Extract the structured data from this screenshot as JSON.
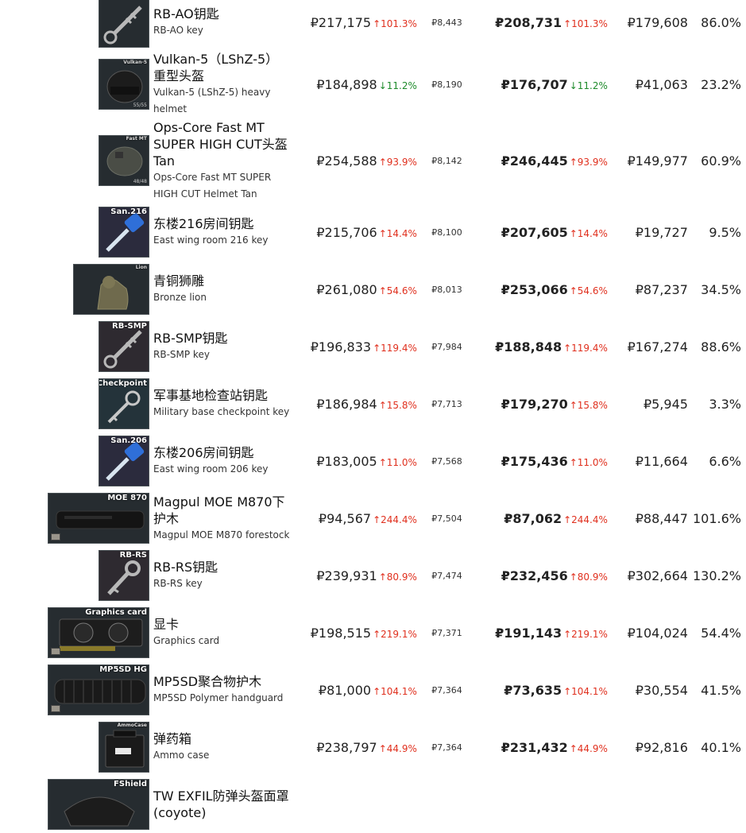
{
  "rows": [
    {
      "cn": "RB-AO钥匙",
      "en": "RB-AO key",
      "icon": "key-icon",
      "tag": "",
      "flea": "₽217,175",
      "flea_chg": "↑101.3%",
      "flea_dir": "up",
      "per_slot": "₽8,443",
      "trader": "₽208,731",
      "trader_chg": "↑101.3%",
      "trader_dir": "up",
      "diff": "₽179,608",
      "pct": "86.0%"
    },
    {
      "cn": "Vulkan-5（LShZ-5）重型头盔",
      "en": "Vulkan-5 (LShZ-5) heavy helmet",
      "icon": "helmet-icon",
      "tag": "Vulkan-5",
      "dur": "55/55",
      "flea": "₽184,898",
      "flea_chg": "↓11.2%",
      "flea_dir": "down",
      "per_slot": "₽8,190",
      "trader": "₽176,707",
      "trader_chg": "↓11.2%",
      "trader_dir": "down",
      "diff": "₽41,063",
      "pct": "23.2%"
    },
    {
      "cn": "Ops-Core Fast MT SUPER HIGH CUT头盔Tan",
      "en": "Ops-Core Fast MT SUPER HIGH CUT Helmet Tan",
      "icon": "helmet-icon",
      "tag": "Fast MT",
      "dur": "48/48",
      "flea": "₽254,588",
      "flea_chg": "↑93.9%",
      "flea_dir": "up",
      "per_slot": "₽8,142",
      "trader": "₽246,445",
      "trader_chg": "↑93.9%",
      "trader_dir": "up",
      "diff": "₽149,977",
      "pct": "60.9%"
    },
    {
      "cn": "东楼216房间钥匙",
      "en": "East wing room 216 key",
      "icon": "key-icon",
      "tag": "San.216",
      "flea": "₽215,706",
      "flea_chg": "↑14.4%",
      "flea_dir": "up",
      "per_slot": "₽8,100",
      "trader": "₽207,605",
      "trader_chg": "↑14.4%",
      "trader_dir": "up",
      "diff": "₽19,727",
      "pct": "9.5%"
    },
    {
      "cn": "青铜狮雕",
      "en": "Bronze lion",
      "icon": "lion-statue-icon",
      "tag": "Lion",
      "flea": "₽261,080",
      "flea_chg": "↑54.6%",
      "flea_dir": "up",
      "per_slot": "₽8,013",
      "trader": "₽253,066",
      "trader_chg": "↑54.6%",
      "trader_dir": "up",
      "diff": "₽87,237",
      "pct": "34.5%"
    },
    {
      "cn": "RB-SMP钥匙",
      "en": "RB-SMP key",
      "icon": "key-icon",
      "tag": "RB-SMP",
      "flea": "₽196,833",
      "flea_chg": "↑119.4%",
      "flea_dir": "up",
      "per_slot": "₽7,984",
      "trader": "₽188,848",
      "trader_chg": "↑119.4%",
      "trader_dir": "up",
      "diff": "₽167,274",
      "pct": "88.6%"
    },
    {
      "cn": "军事基地检查站钥匙",
      "en": "Military base checkpoint key",
      "icon": "key-icon",
      "tag": "Checkpoint",
      "flea": "₽186,984",
      "flea_chg": "↑15.8%",
      "flea_dir": "up",
      "per_slot": "₽7,713",
      "trader": "₽179,270",
      "trader_chg": "↑15.8%",
      "trader_dir": "up",
      "diff": "₽5,945",
      "pct": "3.3%"
    },
    {
      "cn": "东楼206房间钥匙",
      "en": "East wing room 206 key",
      "icon": "key-icon",
      "tag": "San.206",
      "flea": "₽183,005",
      "flea_chg": "↑11.0%",
      "flea_dir": "up",
      "per_slot": "₽7,568",
      "trader": "₽175,436",
      "trader_chg": "↑11.0%",
      "trader_dir": "up",
      "diff": "₽11,664",
      "pct": "6.6%"
    },
    {
      "cn": "Magpul MOE M870下护木",
      "en": "Magpul MOE M870 forestock",
      "icon": "forestock-icon",
      "tag": "MOE 870",
      "flea": "₽94,567",
      "flea_chg": "↑244.4%",
      "flea_dir": "up",
      "per_slot": "₽7,504",
      "trader": "₽87,062",
      "trader_chg": "↑244.4%",
      "trader_dir": "up",
      "diff": "₽88,447",
      "pct": "101.6%"
    },
    {
      "cn": "RB-RS钥匙",
      "en": "RB-RS key",
      "icon": "key-icon",
      "tag": "RB-RS",
      "flea": "₽239,931",
      "flea_chg": "↑80.9%",
      "flea_dir": "up",
      "per_slot": "₽7,474",
      "trader": "₽232,456",
      "trader_chg": "↑80.9%",
      "trader_dir": "up",
      "diff": "₽302,664",
      "pct": "130.2%"
    },
    {
      "cn": "显卡",
      "en": "Graphics card",
      "icon": "graphics-card-icon",
      "tag": "Graphics card",
      "flea": "₽198,515",
      "flea_chg": "↑219.1%",
      "flea_dir": "up",
      "per_slot": "₽7,371",
      "trader": "₽191,143",
      "trader_chg": "↑219.1%",
      "trader_dir": "up",
      "diff": "₽104,024",
      "pct": "54.4%"
    },
    {
      "cn": "MP5SD聚合物护木",
      "en": "MP5SD Polymer handguard",
      "icon": "handguard-icon",
      "tag": "MP5SD HG",
      "flea": "₽81,000",
      "flea_chg": "↑104.1%",
      "flea_dir": "up",
      "per_slot": "₽7,364",
      "trader": "₽73,635",
      "trader_chg": "↑104.1%",
      "trader_dir": "up",
      "diff": "₽30,554",
      "pct": "41.5%"
    },
    {
      "cn": "弹药箱",
      "en": "Ammo case",
      "icon": "ammo-case-icon",
      "tag": "AmmoCase",
      "flea": "₽238,797",
      "flea_chg": "↑44.9%",
      "flea_dir": "up",
      "per_slot": "₽7,364",
      "trader": "₽231,432",
      "trader_chg": "↑44.9%",
      "trader_dir": "up",
      "diff": "₽92,816",
      "pct": "40.1%"
    },
    {
      "cn": "TW EXFIL防弹头盔面罩(coyote)",
      "en": "",
      "icon": "face-shield-icon",
      "tag": "FShield",
      "flea": "",
      "flea_chg": "",
      "flea_dir": "up",
      "per_slot": "",
      "trader": "",
      "trader_chg": "",
      "trader_dir": "up",
      "diff": "",
      "pct": ""
    }
  ]
}
